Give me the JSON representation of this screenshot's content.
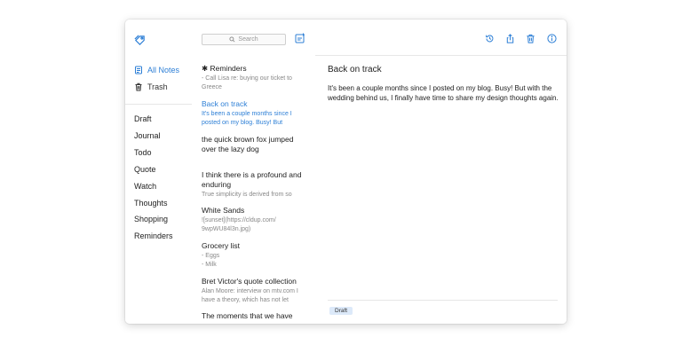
{
  "colors": {
    "accent": "#2d7fd6",
    "tag_bg": "#dce9f9"
  },
  "sidebar": {
    "nav": [
      {
        "label": "All Notes",
        "icon": "notes-icon",
        "active": true
      },
      {
        "label": "Trash",
        "icon": "trash-icon",
        "active": false
      }
    ],
    "folders": [
      "Draft",
      "Journal",
      "Todo",
      "Quote",
      "Watch",
      "Thoughts",
      "Shopping",
      "Reminders"
    ]
  },
  "list": {
    "search_placeholder": "Search",
    "notes": [
      {
        "title": "✱ Reminders",
        "snippet": "- Call Lisa re: buying our ticket to Greece",
        "active": false
      },
      {
        "title": "Back on track",
        "snippet": "It's been a couple months since I posted on my blog. Busy! But",
        "active": true
      },
      {
        "title": "the quick brown fox jumped over the lazy dog",
        "snippet": "",
        "active": false
      },
      {
        "title": "I think there is a profound and enduring",
        "snippet": "True simplicity is derived from so",
        "active": false
      },
      {
        "title": "White Sands",
        "snippet": "![sunset](https://cldup.com/ 9wpWU84l3n.jpg)",
        "active": false
      },
      {
        "title": "Grocery list",
        "snippet": "- Eggs\n- Milk",
        "active": false
      },
      {
        "title": "Bret Victor's quote collection",
        "snippet": "Alan Moore: interview on mtv.com I have a theory, which has not let",
        "active": false
      },
      {
        "title": "The moments that we have",
        "snippet": "",
        "active": false
      }
    ]
  },
  "editor": {
    "title": "Back on track",
    "body": "It's been a couple months since I posted on my blog. Busy! But with the wedding behind us, I finally have time to share my design thoughts again.",
    "tag": "Draft",
    "toolbar": [
      "history-icon",
      "share-icon",
      "trash-icon",
      "info-icon"
    ]
  }
}
